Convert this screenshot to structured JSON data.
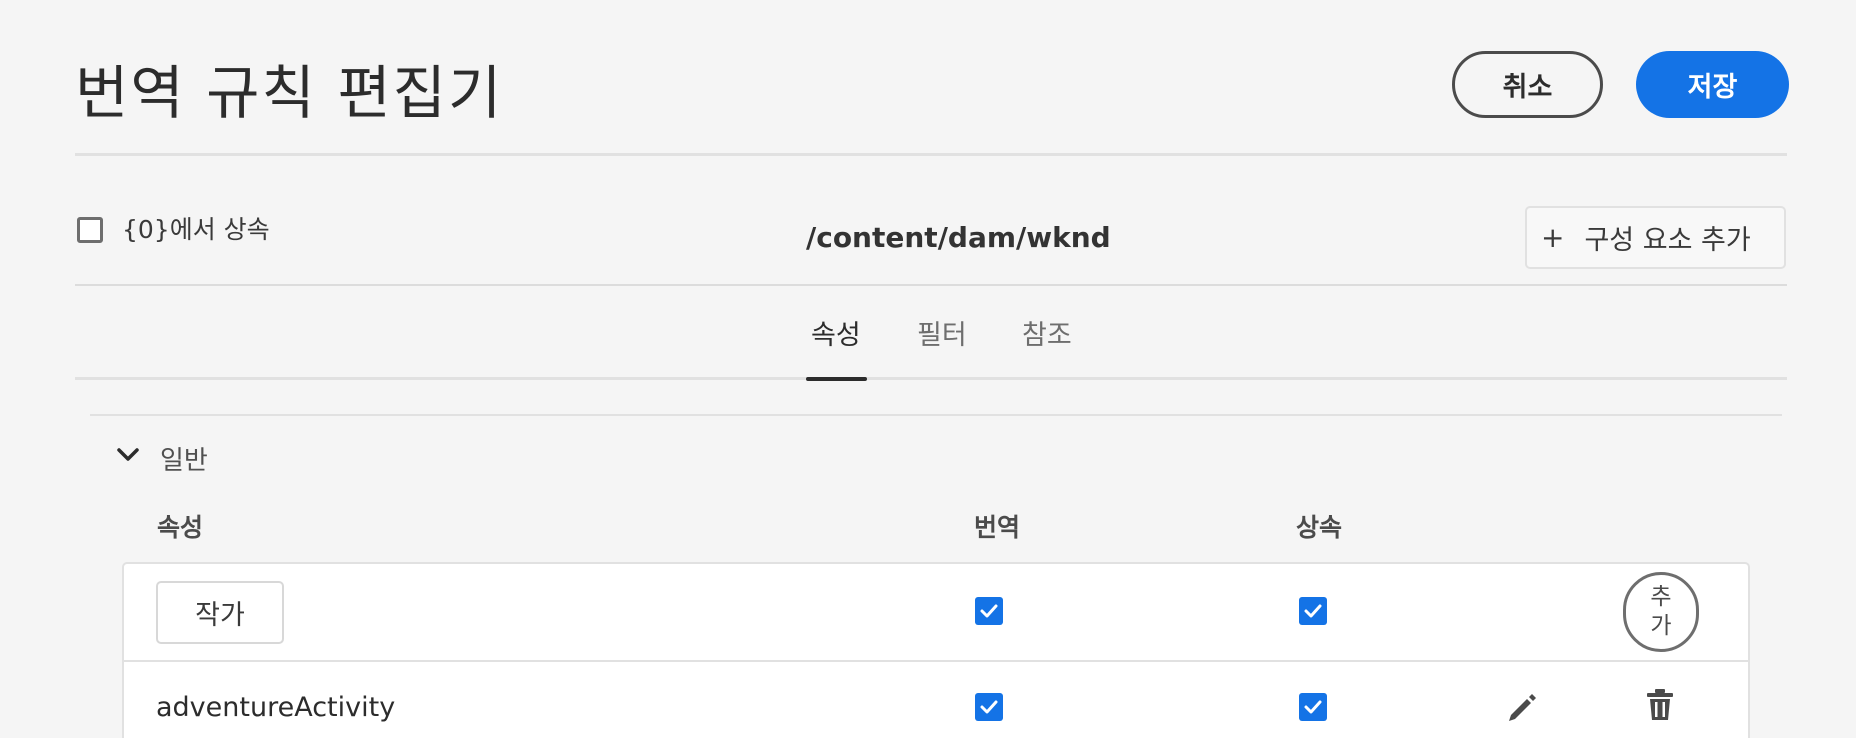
{
  "header": {
    "title": "번역 규칙 편집기",
    "cancel_label": "취소",
    "save_label": "저장"
  },
  "context": {
    "inherit_label": "{0}에서 상속",
    "inherit_checked": false,
    "path": "/content/dam/wknd",
    "add_component_label": "구성 요소 추가"
  },
  "tabs": [
    {
      "label": "속성",
      "active": true
    },
    {
      "label": "필터",
      "active": false
    },
    {
      "label": "참조",
      "active": false
    }
  ],
  "section": {
    "label": "일반",
    "expanded": true,
    "columns": {
      "property": "속성",
      "translate": "번역",
      "inherit": "상속"
    },
    "new_row": {
      "property_value": "작가",
      "translate": true,
      "inherit": true,
      "add_label": "추가"
    },
    "rows": [
      {
        "property": "adventureActivity",
        "translate": true,
        "inherit": true
      }
    ]
  },
  "colors": {
    "accent": "#1473e6",
    "background": "#f5f5f5"
  },
  "icons": [
    "checkbox",
    "plus-icon",
    "chevron-down-icon",
    "check-icon",
    "edit-icon",
    "delete-icon"
  ]
}
